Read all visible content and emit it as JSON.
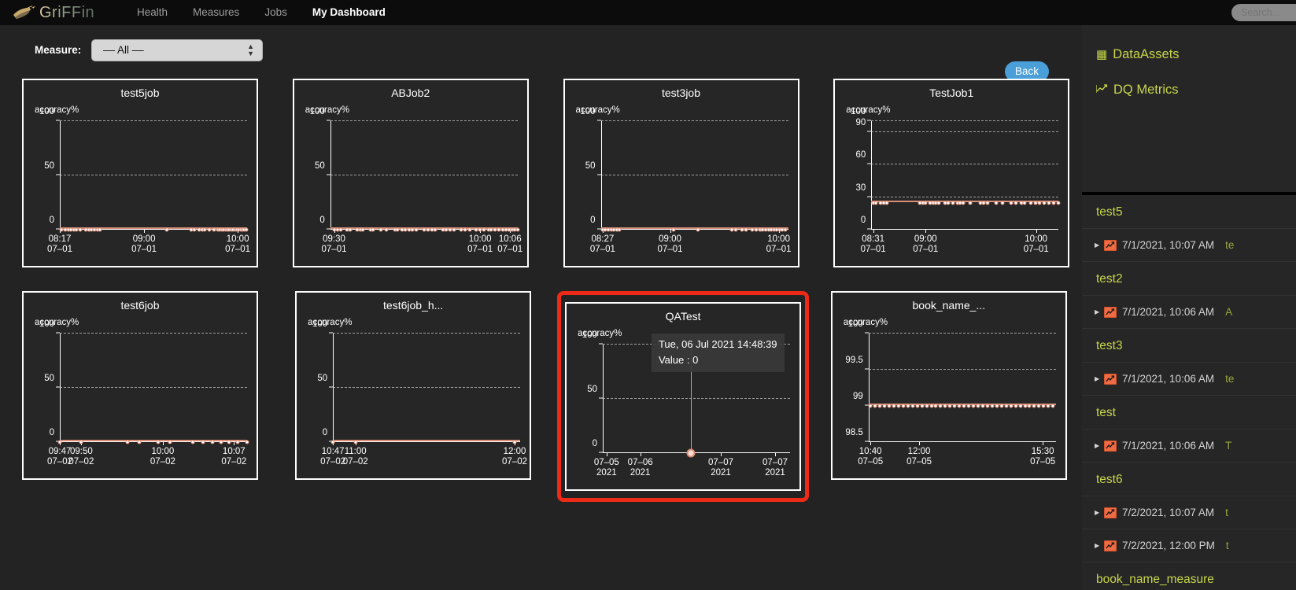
{
  "navbar": {
    "brand": "GriFFin",
    "brand_icon": "griffin-logo-icon",
    "items": [
      {
        "label": "Health",
        "active": false
      },
      {
        "label": "Measures",
        "active": false
      },
      {
        "label": "Jobs",
        "active": false
      },
      {
        "label": "My Dashboard",
        "active": true
      }
    ],
    "search_placeholder": "Search...",
    "search_value": ""
  },
  "toolbar": {
    "measure_label": "Measure:",
    "measure_value": "–– All ––",
    "back_label": "Back"
  },
  "colors": {
    "accent_line": "#d98e78",
    "highlight_border": "#ec2a17",
    "sidebar_link": "#c8d64a",
    "back_button": "#4a9fd8",
    "background": "#232323"
  },
  "chart_data": [
    {
      "type": "line",
      "title": "test5job",
      "ylabel": "accuracy%",
      "ylim": [
        0,
        100
      ],
      "yticks": [
        0,
        50,
        100
      ],
      "gridlines": [
        50,
        100
      ],
      "xticks": [
        {
          "pos": 0.0,
          "line1": "08:17",
          "line2": "07–01"
        },
        {
          "pos": 0.45,
          "line1": "09:00",
          "line2": "07–01"
        },
        {
          "pos": 0.95,
          "line1": "10:00",
          "line2": "07–01"
        }
      ],
      "value": 0,
      "points": [
        0.01,
        0.03,
        0.045,
        0.06,
        0.075,
        0.09,
        0.11,
        0.14,
        0.155,
        0.17,
        0.185,
        0.2,
        0.215,
        0.57,
        0.7,
        0.72,
        0.745,
        0.76,
        0.775,
        0.8,
        0.825,
        0.845,
        0.855,
        0.865,
        0.875,
        0.885,
        0.895,
        0.905,
        0.915,
        0.925,
        0.935,
        0.945,
        0.955,
        0.965,
        0.975,
        0.985,
        0.995
      ]
    },
    {
      "type": "line",
      "title": "ABJob2",
      "ylabel": "accuracy%",
      "ylim": [
        0,
        100
      ],
      "yticks": [
        0,
        50,
        100
      ],
      "gridlines": [
        50,
        100
      ],
      "xticks": [
        {
          "pos": 0.02,
          "line1": "09:30",
          "line2": "07–01"
        },
        {
          "pos": 0.8,
          "line1": "10:00",
          "line2": "07–01"
        },
        {
          "pos": 0.96,
          "line1": "10:06",
          "line2": "07–01"
        }
      ],
      "value": 0,
      "points": [
        0.02,
        0.04,
        0.055,
        0.09,
        0.105,
        0.145,
        0.16,
        0.175,
        0.215,
        0.23,
        0.27,
        0.3,
        0.345,
        0.36,
        0.385,
        0.4,
        0.42,
        0.44,
        0.46,
        0.5,
        0.52,
        0.545,
        0.56,
        0.6,
        0.62,
        0.64,
        0.66,
        0.7,
        0.72,
        0.745,
        0.78,
        0.8,
        0.82,
        0.845,
        0.86,
        0.88,
        0.9,
        0.92,
        0.94,
        0.955,
        0.97,
        0.985,
        1.0
      ]
    },
    {
      "type": "line",
      "title": "test3job",
      "ylabel": "accuracy%",
      "ylim": [
        0,
        100
      ],
      "yticks": [
        0,
        50,
        100
      ],
      "gridlines": [
        50,
        100
      ],
      "xticks": [
        {
          "pos": 0.01,
          "line1": "08:27",
          "line2": "07–01"
        },
        {
          "pos": 0.37,
          "line1": "09:00",
          "line2": "07–01"
        },
        {
          "pos": 0.95,
          "line1": "10:00",
          "line2": "07–01"
        }
      ],
      "value": 0,
      "points": [
        0.01,
        0.025,
        0.04,
        0.055,
        0.07,
        0.085,
        0.1,
        0.39,
        0.52,
        0.7,
        0.72,
        0.755,
        0.775,
        0.81,
        0.83,
        0.85,
        0.865,
        0.88,
        0.895,
        0.91,
        0.925,
        0.94,
        0.955,
        0.97,
        0.985
      ]
    },
    {
      "type": "line",
      "title": "TestJob1",
      "ylabel": "accuracy%",
      "ylim": [
        0,
        100
      ],
      "yticks": [
        0,
        30,
        60,
        90,
        100
      ],
      "gridlines": [
        30,
        60,
        90,
        100
      ],
      "xticks": [
        {
          "pos": 0.01,
          "line1": "08:31",
          "line2": "07–01"
        },
        {
          "pos": 0.29,
          "line1": "09:00",
          "line2": "07–01"
        },
        {
          "pos": 0.88,
          "line1": "10:00",
          "line2": "07–01"
        }
      ],
      "value": 25,
      "points": [
        0.01,
        0.025,
        0.05,
        0.065,
        0.085,
        0.26,
        0.275,
        0.29,
        0.315,
        0.33,
        0.345,
        0.36,
        0.395,
        0.41,
        0.435,
        0.46,
        0.475,
        0.49,
        0.53,
        0.585,
        0.6,
        0.62,
        0.665,
        0.7,
        0.745,
        0.77,
        0.8,
        0.82,
        0.85,
        0.875,
        0.9,
        0.925,
        0.95,
        0.975,
        1.0
      ]
    },
    {
      "type": "line",
      "title": "test6job",
      "ylabel": "accuracy%",
      "ylim": [
        0,
        100
      ],
      "yticks": [
        0,
        50,
        100
      ],
      "gridlines": [
        50,
        100
      ],
      "xticks": [
        {
          "pos": 0.0,
          "line1": "09:47",
          "line2": "07–02"
        },
        {
          "pos": 0.115,
          "line1": "09:50",
          "line2": "07–02"
        },
        {
          "pos": 0.55,
          "line1": "10:00",
          "line2": "07–02"
        },
        {
          "pos": 0.93,
          "line1": "10:07",
          "line2": "07–02"
        }
      ],
      "value": 0,
      "points": [
        0.0,
        0.115,
        0.36,
        0.425,
        0.525,
        0.59,
        0.71,
        0.765,
        0.815,
        0.86,
        0.905,
        0.95,
        1.0
      ]
    },
    {
      "type": "line",
      "title": "test6job_h...",
      "ylabel": "accuracy%",
      "ylim": [
        0,
        100
      ],
      "yticks": [
        0,
        50,
        100
      ],
      "gridlines": [
        50,
        100
      ],
      "xticks": [
        {
          "pos": 0.0,
          "line1": "10:47",
          "line2": "07–02"
        },
        {
          "pos": 0.12,
          "line1": "11:00",
          "line2": "07–02"
        },
        {
          "pos": 0.97,
          "line1": "12:00",
          "line2": "07–02"
        }
      ],
      "value": 0,
      "points": [
        0.0,
        0.12,
        0.97
      ]
    },
    {
      "type": "line",
      "title": "QATest",
      "ylabel": "accuracy%",
      "ylim": [
        0,
        100
      ],
      "yticks": [
        0,
        50,
        100
      ],
      "gridlines": [
        50,
        100
      ],
      "xticks": [
        {
          "pos": 0.02,
          "line1": "07–05",
          "line2": "2021"
        },
        {
          "pos": 0.2,
          "line1": "07–06",
          "line2": "2021"
        },
        {
          "pos": 0.63,
          "line1": "07–07",
          "line2": "2021"
        },
        {
          "pos": 0.92,
          "line1": "07–07",
          "line2": "2021"
        }
      ],
      "value": 0,
      "points": [],
      "highlighted": true,
      "tooltip": {
        "timestamp": "Tue, 06 Jul 2021 14:48:39",
        "value_label": "Value : 0",
        "x_pos": 0.47
      }
    },
    {
      "type": "line",
      "title": "book_name_...",
      "ylabel": "accuracy%",
      "ylim": [
        98.5,
        100
      ],
      "yticks": [
        98.5,
        99,
        99.5,
        100
      ],
      "gridlines": [
        99.5,
        100
      ],
      "xticks": [
        {
          "pos": 0.01,
          "line1": "10:40",
          "line2": "07–05"
        },
        {
          "pos": 0.27,
          "line1": "12:00",
          "line2": "07–05"
        },
        {
          "pos": 0.93,
          "line1": "15:30",
          "line2": "07–05"
        }
      ],
      "value": 99,
      "points": [
        0.01,
        0.035,
        0.06,
        0.085,
        0.11,
        0.135,
        0.16,
        0.185,
        0.21,
        0.235,
        0.26,
        0.285,
        0.31,
        0.335,
        0.36,
        0.385,
        0.41,
        0.435,
        0.46,
        0.485,
        0.51,
        0.535,
        0.56,
        0.585,
        0.61,
        0.635,
        0.66,
        0.685,
        0.71,
        0.735,
        0.76,
        0.785,
        0.81,
        0.835,
        0.86,
        0.885,
        0.91,
        0.935,
        0.96,
        0.985
      ]
    }
  ],
  "sidebar": {
    "nav": [
      {
        "label": "DataAssets",
        "icon": "table-icon",
        "glyph": "▦"
      },
      {
        "label": "DQ Metrics",
        "icon": "line-chart-icon",
        "glyph": "📈"
      }
    ],
    "tree": [
      {
        "kind": "group",
        "label": "test5"
      },
      {
        "kind": "row",
        "time": "7/1/2021, 10:07 AM",
        "extra": "te"
      },
      {
        "kind": "group",
        "label": "test2"
      },
      {
        "kind": "row",
        "time": "7/1/2021, 10:06 AM",
        "extra": "A"
      },
      {
        "kind": "group",
        "label": "test3"
      },
      {
        "kind": "row",
        "time": "7/1/2021, 10:06 AM",
        "extra": "te"
      },
      {
        "kind": "group",
        "label": "test"
      },
      {
        "kind": "row",
        "time": "7/1/2021, 10:06 AM",
        "extra": "T"
      },
      {
        "kind": "group",
        "label": "test6"
      },
      {
        "kind": "row",
        "time": "7/2/2021, 10:07 AM",
        "extra": "t"
      },
      {
        "kind": "row",
        "time": "7/2/2021, 12:00 PM",
        "extra": "t"
      },
      {
        "kind": "group",
        "label": "book_name_measure"
      }
    ]
  }
}
